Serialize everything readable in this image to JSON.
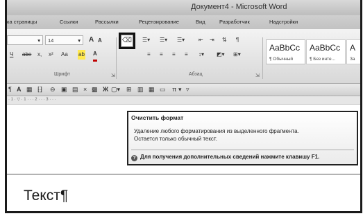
{
  "window": {
    "title": "Документ4 - Microsoft Word"
  },
  "tabs": [
    "ка страницы",
    "Ссылки",
    "Рассылки",
    "Рецензирование",
    "Вид",
    "Разработчик",
    "Надстройки"
  ],
  "ribbon": {
    "font": {
      "size_value": "14",
      "grow_label": "A",
      "shrink_label": "A",
      "underline_label": "Ч",
      "strike_label": "abe",
      "subscript_label": "x,",
      "superscript_label": "x²",
      "case_label": "Aa",
      "highlight_label": "ab",
      "color_label": "A",
      "group_label": "Шрифт"
    },
    "paragraph": {
      "group_label": "Абзац"
    },
    "styles": [
      {
        "sample": "AaBbCc",
        "name": "¶ Обычный"
      },
      {
        "sample": "AaBbCc",
        "name": "¶ Без инте..."
      },
      {
        "sample": "A",
        "name": "За"
      }
    ]
  },
  "toolbar2": {
    "pi_label": "π"
  },
  "ruler": {
    "ticks": "· 1 · ▽ · 1 · · · 2 · · · 3 · · ·"
  },
  "tooltip": {
    "title": "Очистить формат",
    "body_line1": "Удаление любого форматирования из выделенного фрагмента.",
    "body_line2": "Остается только обычный текст.",
    "help": "Для получения дополнительных сведений нажмите клавишу F1."
  },
  "document": {
    "text": "Текст¶"
  }
}
